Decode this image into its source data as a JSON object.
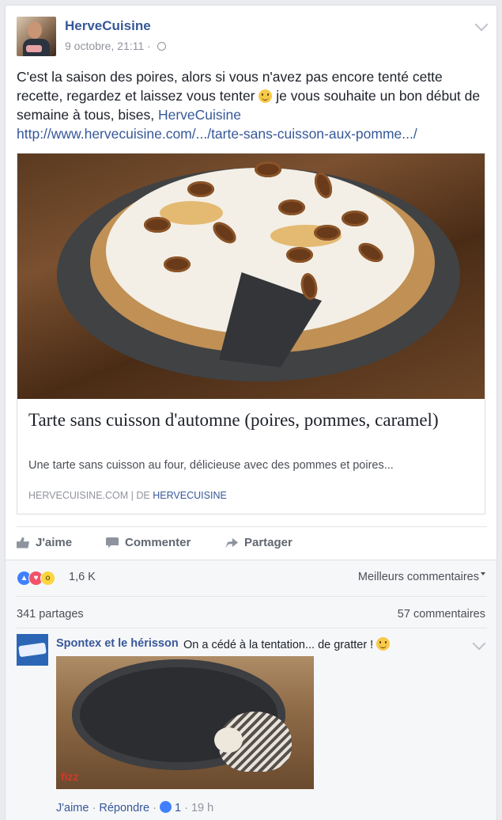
{
  "post": {
    "author": "HerveCuisine",
    "date": "9 octobre, 21:11",
    "date_sep": "·",
    "text_before": "C'est la saison des poires, alors si vous n'avez pas encore tenté cette recette, regardez et laissez vous tenter ",
    "text_after": " je vous souhaite un bon début de semaine à tous, bises, ",
    "text_mention": "HerveCuisine",
    "url": "http://www.hervecuisine.com/.../tarte-sans-cuisson-aux-pomme.../"
  },
  "link_card": {
    "title": "Tarte sans cuisson d'automne (poires, pommes, caramel)",
    "description": "Une tarte sans cuisson au four, délicieuse avec des pommes et poires...",
    "domain": "HERVECUISINE.COM",
    "separator": "|",
    "by": "DE",
    "author": "HERVECUISINE"
  },
  "actions": {
    "like": "J'aime",
    "comment": "Commenter",
    "share": "Partager"
  },
  "reactions": {
    "count": "1,6 K",
    "sort_label": "Meilleurs commentaires",
    "shares": "341 partages",
    "comments": "57 commentaires"
  },
  "comment": {
    "author": "Spontex et le hérisson",
    "text": "On a cédé à la tentation... de gratter ! ",
    "photo_brand": "fizz",
    "like_label": "J'aime",
    "reply_label": "Répondre",
    "sep": "·",
    "like_count": "1",
    "time": "19 h"
  },
  "colors": {
    "link": "#365899",
    "like_blue": "#4080ff",
    "love_red": "#f25268",
    "wow_yellow": "#fcd53f"
  }
}
